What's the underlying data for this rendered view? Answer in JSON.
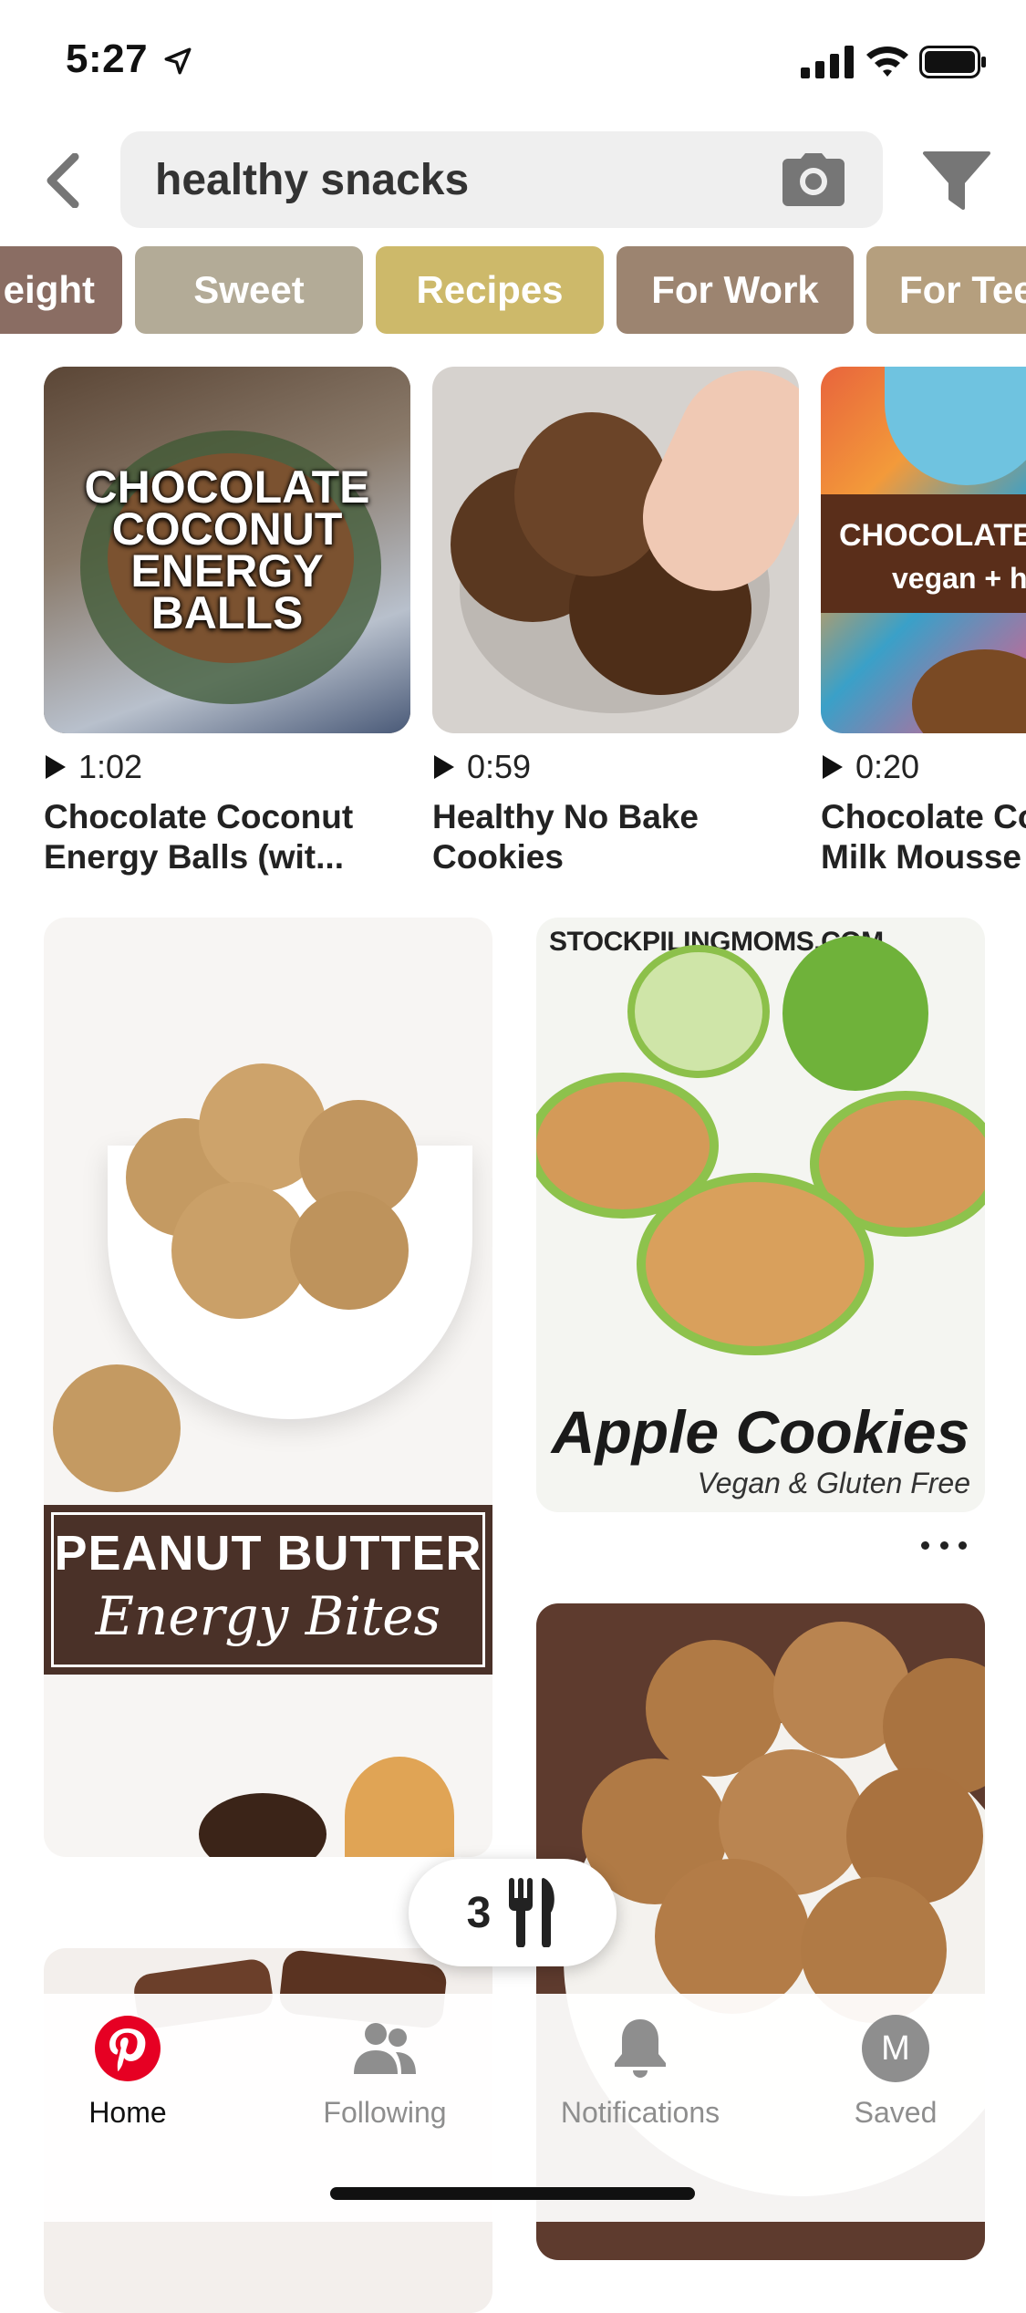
{
  "status_bar": {
    "time": "5:27"
  },
  "search": {
    "query": "healthy snacks"
  },
  "chips": [
    {
      "label": "eight",
      "color": "#8a6d63"
    },
    {
      "label": "Sweet",
      "color": "#b3ab97"
    },
    {
      "label": "Recipes",
      "color": "#cdb96a"
    },
    {
      "label": "For Work",
      "color": "#9c8470"
    },
    {
      "label": "For Tee",
      "color": "#b59f7e"
    }
  ],
  "videos": [
    {
      "duration": "1:02",
      "title": "Chocolate Coconut\nEnergy Balls (wit...",
      "overlay": "CHOCOLATE\nCOCONUT\nENERGY\nBALLS"
    },
    {
      "duration": "0:59",
      "title": "Healthy No Bake\nCookies"
    },
    {
      "duration": "0:20",
      "title": "Chocolate Co\nMilk Mousse",
      "overlay_main": "CHOCOLATE",
      "overlay_sub": "vegan + h"
    }
  ],
  "pins": {
    "peanut": {
      "line1": "PEANUT BUTTER",
      "line2": "Energy Bites"
    },
    "apple": {
      "watermark": "STOCKPILINGMOMS.COM",
      "title": "Apple Cookies",
      "subtitle": "Vegan & Gluten Free"
    }
  },
  "recipe_pill": {
    "count": "3"
  },
  "nav": {
    "home": "Home",
    "following": "Following",
    "notifications": "Notifications",
    "saved": "Saved",
    "avatar_initial": "M"
  },
  "colors": {
    "brand_red": "#e60023",
    "chip_recipes": "#cdb96a"
  }
}
